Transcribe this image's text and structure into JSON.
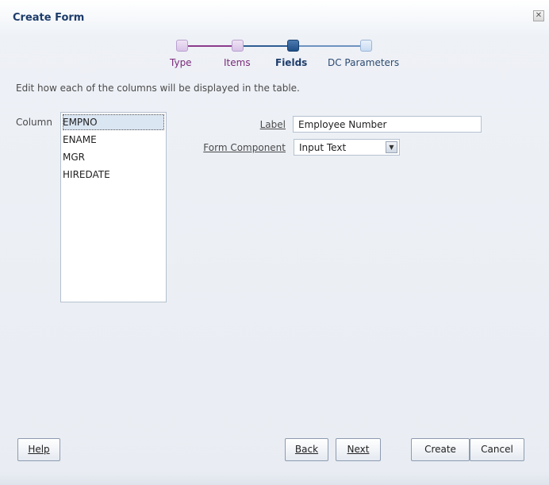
{
  "dialog": {
    "title": "Create Form",
    "close_glyph": "✕"
  },
  "train": {
    "stops": [
      {
        "label": "Type",
        "state": "visited"
      },
      {
        "label": "Items",
        "state": "visited"
      },
      {
        "label": "Fields",
        "state": "current"
      },
      {
        "label": "DC Parameters",
        "state": "future"
      }
    ],
    "colors": {
      "visited": "#7a2a7a",
      "current": "#1f4f87",
      "future": "#9cb6d6"
    }
  },
  "instruction": "Edit how each of the columns will be displayed in the table.",
  "columns": {
    "label": "Column",
    "items": [
      "EMPNO",
      "ENAME",
      "MGR",
      "HIREDATE"
    ],
    "selected": "EMPNO"
  },
  "form": {
    "label_field": {
      "label": "Label",
      "value": "Employee Number"
    },
    "component_field": {
      "label": "Form Component",
      "value": "Input Text"
    }
  },
  "buttons": {
    "help": "Help",
    "back": "Back",
    "next": "Next",
    "create": "Create",
    "cancel": "Cancel"
  }
}
